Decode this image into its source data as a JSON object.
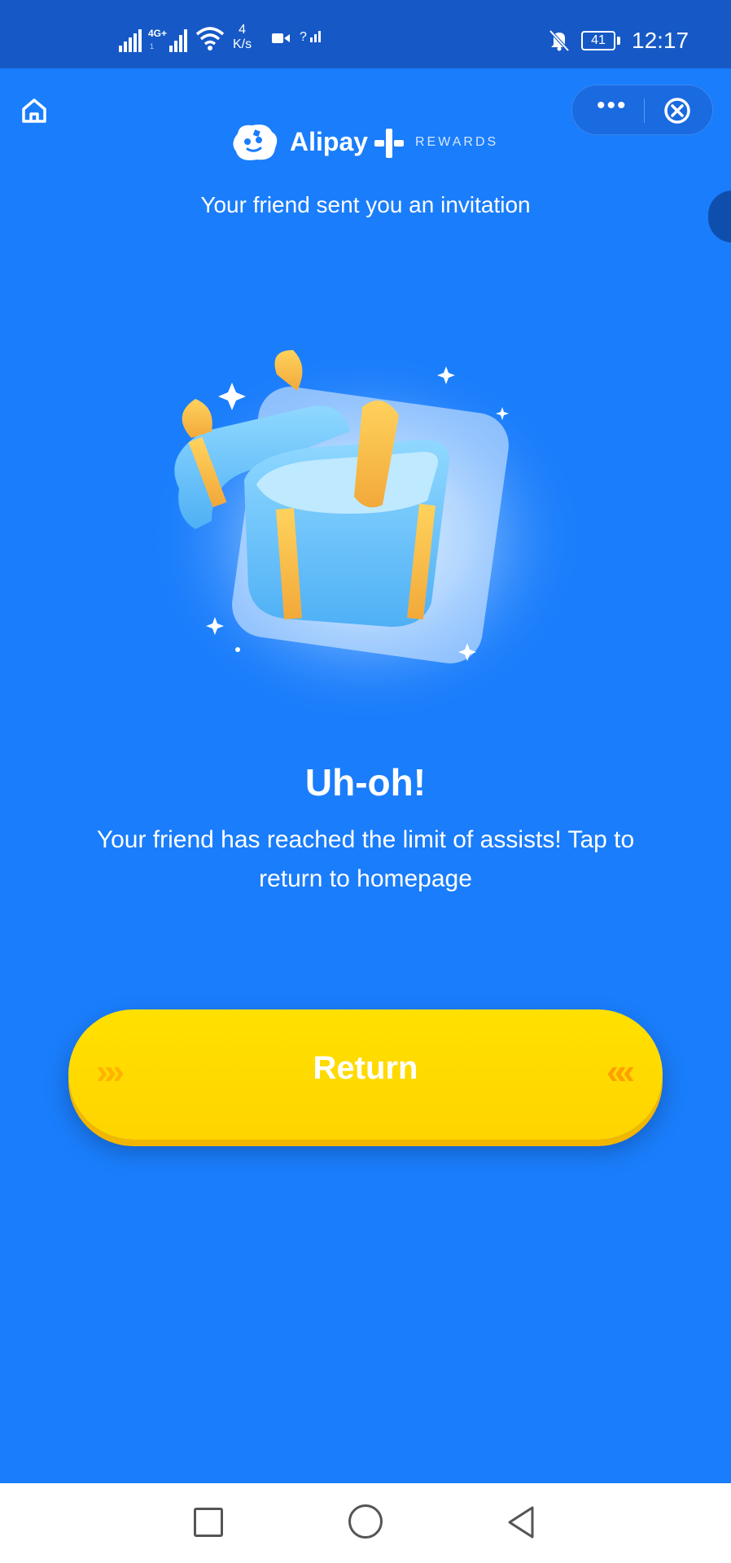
{
  "status_bar": {
    "network_type": "4G+",
    "sim_label": "1",
    "speed": "4",
    "speed_unit": "K/s",
    "signal2_label": "?",
    "battery": "41",
    "time": "12:17"
  },
  "header": {
    "brand_name": "Alipay",
    "brand_tag": "REWARDS",
    "capsule_more": "•••"
  },
  "invite_text": "Your friend sent you an invitation",
  "main": {
    "title": "Uh-oh!",
    "description": "Your friend has reached the limit of assists! Tap to return to homepage"
  },
  "return_button": {
    "label": "Return",
    "chevrons_left": "»»",
    "chevrons_right": "««"
  },
  "colors": {
    "background": "#1a7dfb",
    "status_bar": "#1659c6",
    "button": "#ffdc00"
  },
  "icons": {
    "home": "home-icon",
    "close": "close-circle-icon",
    "more": "more-dots-icon",
    "gift": "gift-box-icon",
    "nav_recents": "square-icon",
    "nav_home": "circle-icon",
    "nav_back": "triangle-back-icon"
  }
}
